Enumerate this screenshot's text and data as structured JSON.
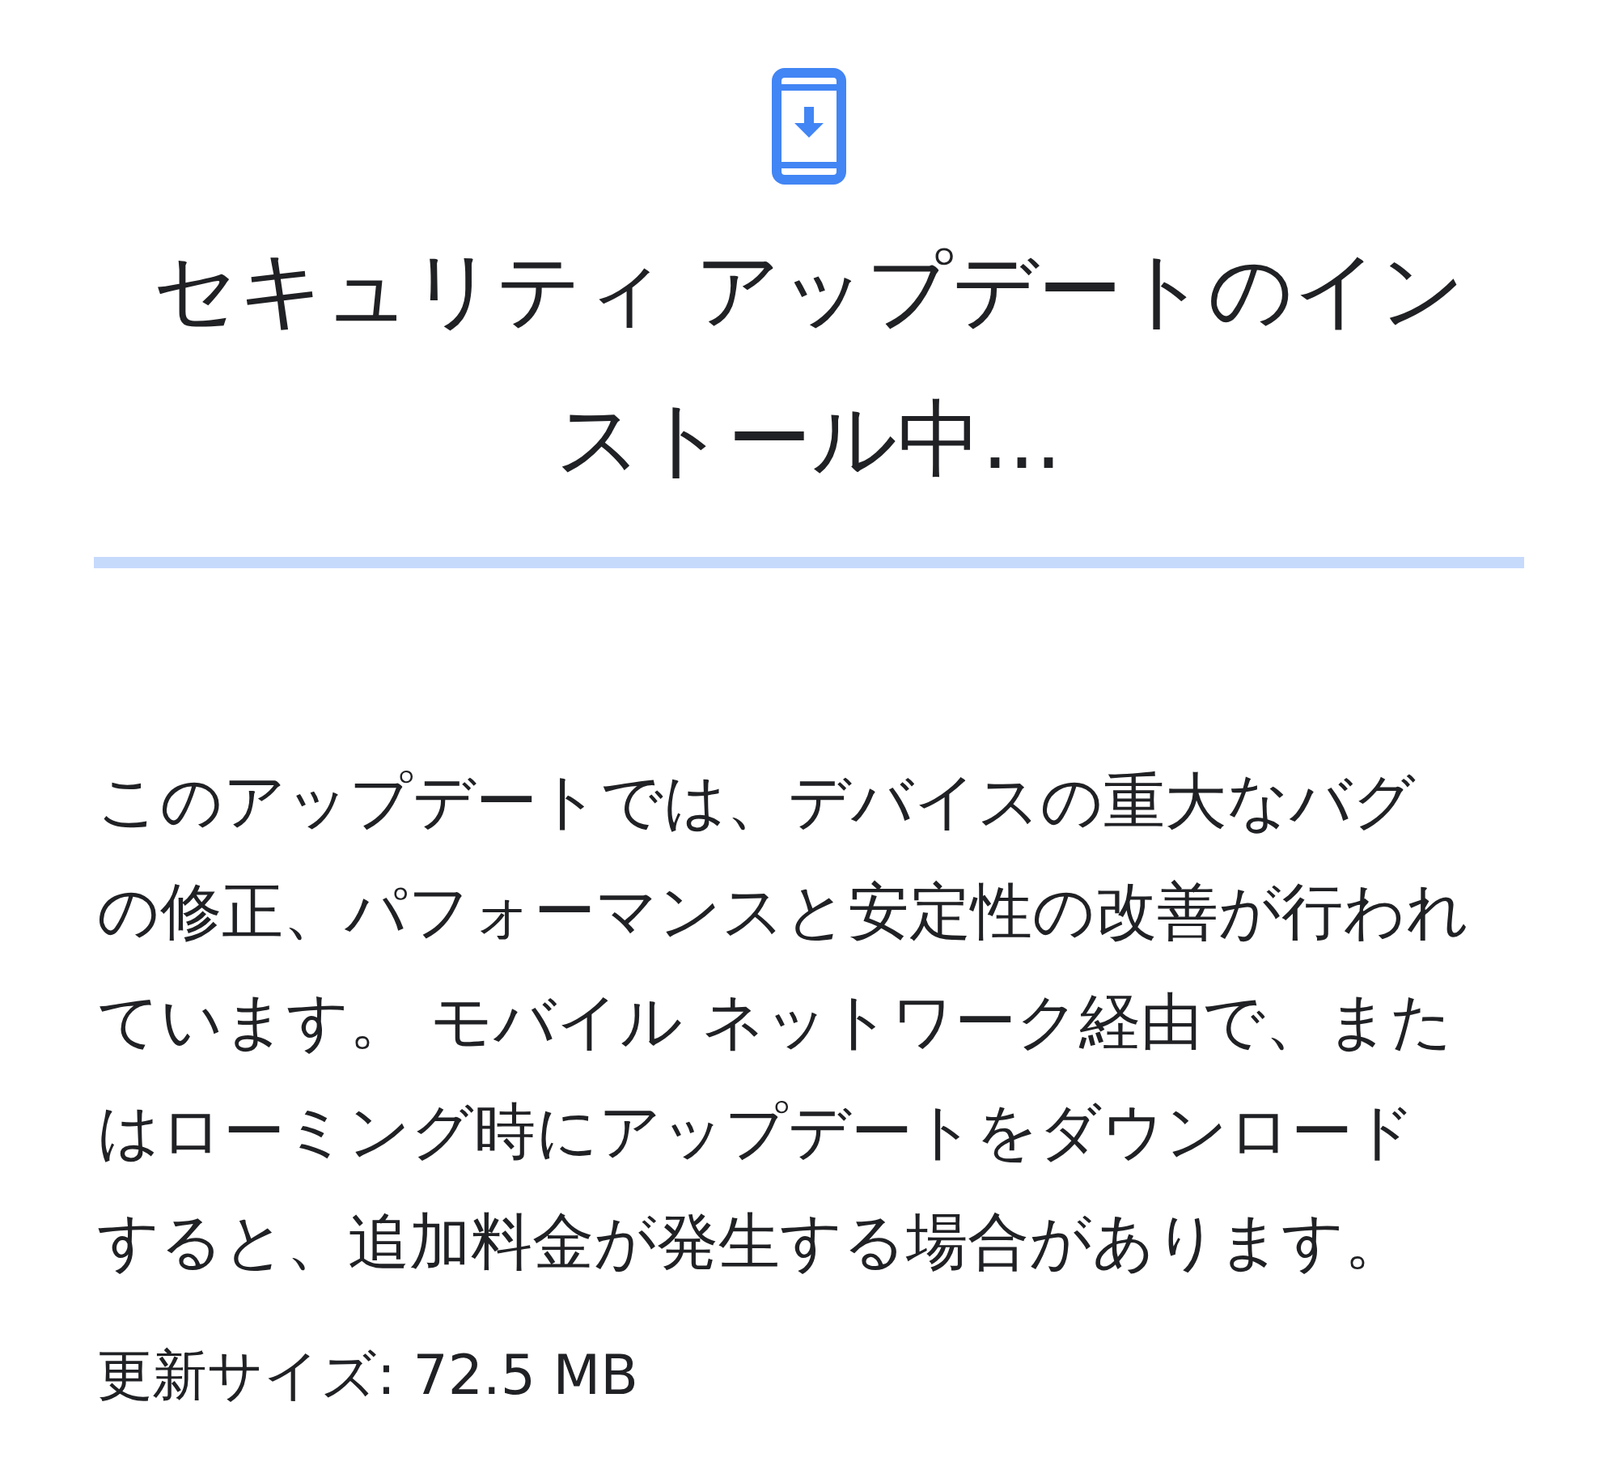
{
  "title": "セキュリティ アップデートのインストール中...",
  "progress": {
    "level": 0
  },
  "description": "このアップデートでは、デバイスの重大なバグの修正、パフォーマンスと安定性の改善が行われています。 モバイル ネットワーク経由で、またはローミング時にアップデートをダウンロードすると、追加料金が発生する場合があります。",
  "update_size": "更新サイズ: 72.5 MB"
}
